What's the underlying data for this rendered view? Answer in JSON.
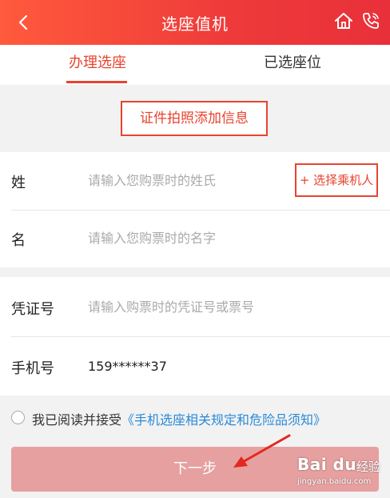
{
  "header": {
    "title": "选座值机",
    "back_icon": "chevron-left-icon",
    "home_icon": "home-icon",
    "phone_icon": "phone-icon"
  },
  "tabs": [
    {
      "label": "办理选座",
      "active": true
    },
    {
      "label": "已选座位",
      "active": false
    }
  ],
  "photo_button": {
    "label": "证件拍照添加信息"
  },
  "form": {
    "surname": {
      "label": "姓",
      "placeholder": "请输入您购票时的姓氏"
    },
    "select_passenger": {
      "label": "+ 选择乘机人"
    },
    "given_name": {
      "label": "名",
      "placeholder": "请输入您购票时的名字"
    },
    "document_no": {
      "label": "凭证号",
      "placeholder": "请输入购票时的凭证号或票号"
    },
    "phone": {
      "label": "手机号",
      "value": "159******37"
    }
  },
  "agreement": {
    "text": "我已阅读并接受",
    "link": "《手机选座相关规定和危险品须知》",
    "checked": false
  },
  "next_button": {
    "label": "下一步"
  },
  "watermark": {
    "brand": "Bai du",
    "suffix": "经验",
    "url": "jingyan.baidu.com"
  },
  "colors": {
    "accent": "#e8432e",
    "header_start": "#ff5a3c",
    "header_end": "#e8303a",
    "link": "#2a8ad8",
    "next_button_bg": "#e6a0a0"
  }
}
